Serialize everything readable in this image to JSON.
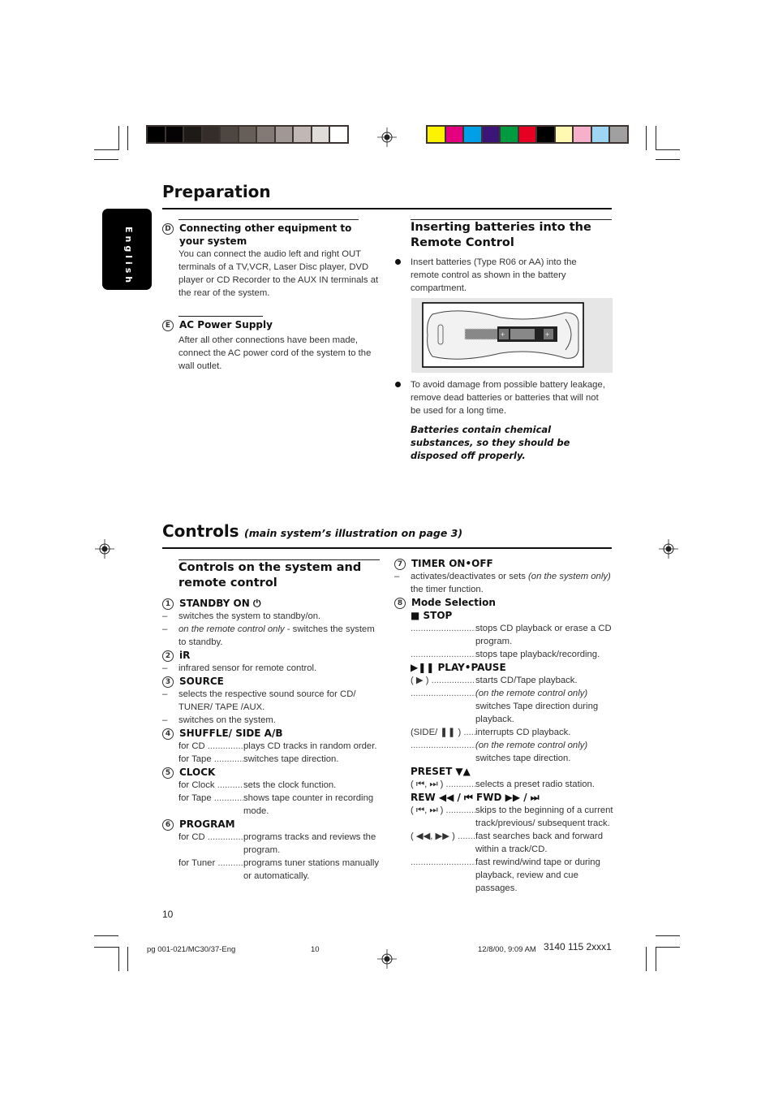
{
  "print_marks": {
    "gray_swatches": [
      "#000000",
      "#060304",
      "#1e1a17",
      "#352d29",
      "#4e4640",
      "#675e58",
      "#847a75",
      "#a29893",
      "#c1b8b3",
      "#e0dcd9",
      "#ffffff"
    ],
    "color_swatches": [
      "#fff200",
      "#e4007f",
      "#00a0e9",
      "#3b1577",
      "#009b3e",
      "#e60021",
      "#000000",
      "#fff9b1",
      "#f7b0c9",
      "#9ed5f3",
      "#a0a0a0"
    ]
  },
  "language_tab": "English",
  "preparation": {
    "title": "Preparation",
    "sections": [
      {
        "marker": "D",
        "heading": "Connecting other equipment to your system",
        "text": "You can connect the audio left and right OUT terminals of a  TV,VCR, Laser Disc player, DVD player or CD Recorder to the AUX IN terminals at the rear of the system."
      },
      {
        "marker": "E",
        "heading": "AC Power Supply",
        "text": "After all other connections have been made, connect the AC power cord of the system to the wall outlet."
      }
    ],
    "batteries": {
      "heading": "Inserting batteries into the Remote Control",
      "bullets": [
        "Insert batteries (Type R06 or AA) into the remote control as shown in the battery compartment.",
        "To avoid damage from possible battery leakage, remove dead batteries or batteries that will not be used for a long time."
      ],
      "warning": "Batteries contain chemical substances, so they should be disposed off properly.",
      "illustration": "remote-control-battery-compartment"
    }
  },
  "controls": {
    "title": "Controls",
    "subtitle": "(main system’s illustration on page 3)",
    "section_heading": "Controls on the system and remote control",
    "left_items": [
      {
        "num": "1",
        "heading": "STANDBY ON ⏻",
        "lines": [
          {
            "type": "dash",
            "text": "switches the system to standby/on."
          },
          {
            "type": "dash",
            "italic": "on the remote control only",
            "text": " - switches the system to standby."
          }
        ]
      },
      {
        "num": "2",
        "heading": "iR",
        "lines": [
          {
            "type": "dash",
            "text": "infrared sensor for remote control."
          }
        ]
      },
      {
        "num": "3",
        "heading": "SOURCE",
        "lines": [
          {
            "type": "dash",
            "text": "selects the respective sound source for CD/ TUNER/ TAPE /AUX."
          },
          {
            "type": "dash",
            "text": "switches on the system."
          }
        ]
      },
      {
        "num": "4",
        "heading": "SHUFFLE/ SIDE A/B",
        "rows": [
          {
            "label": "for CD",
            "value": "plays CD tracks in random order."
          },
          {
            "label": "for Tape",
            "value": "switches tape direction."
          }
        ]
      },
      {
        "num": "5",
        "heading": "CLOCK",
        "rows": [
          {
            "label": "for Clock",
            "value": "sets the clock function."
          },
          {
            "label": "for Tape",
            "value": "shows tape counter in recording mode."
          }
        ]
      },
      {
        "num": "6",
        "heading": "PROGRAM",
        "rows": [
          {
            "label": "for CD",
            "value": "programs tracks and reviews the program."
          },
          {
            "label": "for Tuner",
            "value": "programs tuner stations manually or automatically."
          }
        ]
      }
    ],
    "timer": {
      "num": "7",
      "heading": "TIMER ON•OFF",
      "text_a": "activates/deactivates or sets ",
      "italic": "(on the system only)",
      "text_b": " the timer function."
    },
    "mode": {
      "num": "8",
      "heading": "Mode Selection",
      "stop": {
        "heading": "■  STOP",
        "rows": [
          {
            "label": "",
            "value": "stops CD playback or erase a CD program."
          },
          {
            "label": "",
            "value": "stops tape playback/recording."
          }
        ]
      },
      "play": {
        "heading": "▶❚❚  PLAY•PAUSE",
        "rows": [
          {
            "label": "( ▶ )",
            "value": "starts CD/Tape playback."
          },
          {
            "label": "",
            "italic": "(on the remote control only)",
            "value": "switches Tape direction during playback."
          },
          {
            "label": "(SIDE/ ❚❚ )",
            "value": "interrupts CD playback."
          },
          {
            "label": "",
            "italic": "(on the remote control only)",
            "value": "switches tape direction."
          }
        ]
      },
      "preset": {
        "heading": "PRESET ▼▲",
        "rows": [
          {
            "label": "( ⏮, ⏭ )",
            "value": "selects a preset radio station."
          }
        ]
      },
      "rewfwd": {
        "heading": "REW ◀◀ / ⏮    FWD ▶▶ / ⏭",
        "rows": [
          {
            "label": "( ⏮, ⏭ )",
            "value": "skips to the beginning of a current track/previous/ subsequent track."
          },
          {
            "label": "( ◀◀, ▶▶ )",
            "value": "fast searches back and forward within a track/CD."
          },
          {
            "label": "",
            "value": "fast rewind/wind tape or during playback, review and cue passages."
          }
        ]
      }
    }
  },
  "page_number": "10",
  "footer": {
    "file": "pg 001-021/MC30/37-Eng",
    "page": "10",
    "date": "12/8/00, 9:09 AM",
    "code": "3140 115 2xxx1"
  }
}
